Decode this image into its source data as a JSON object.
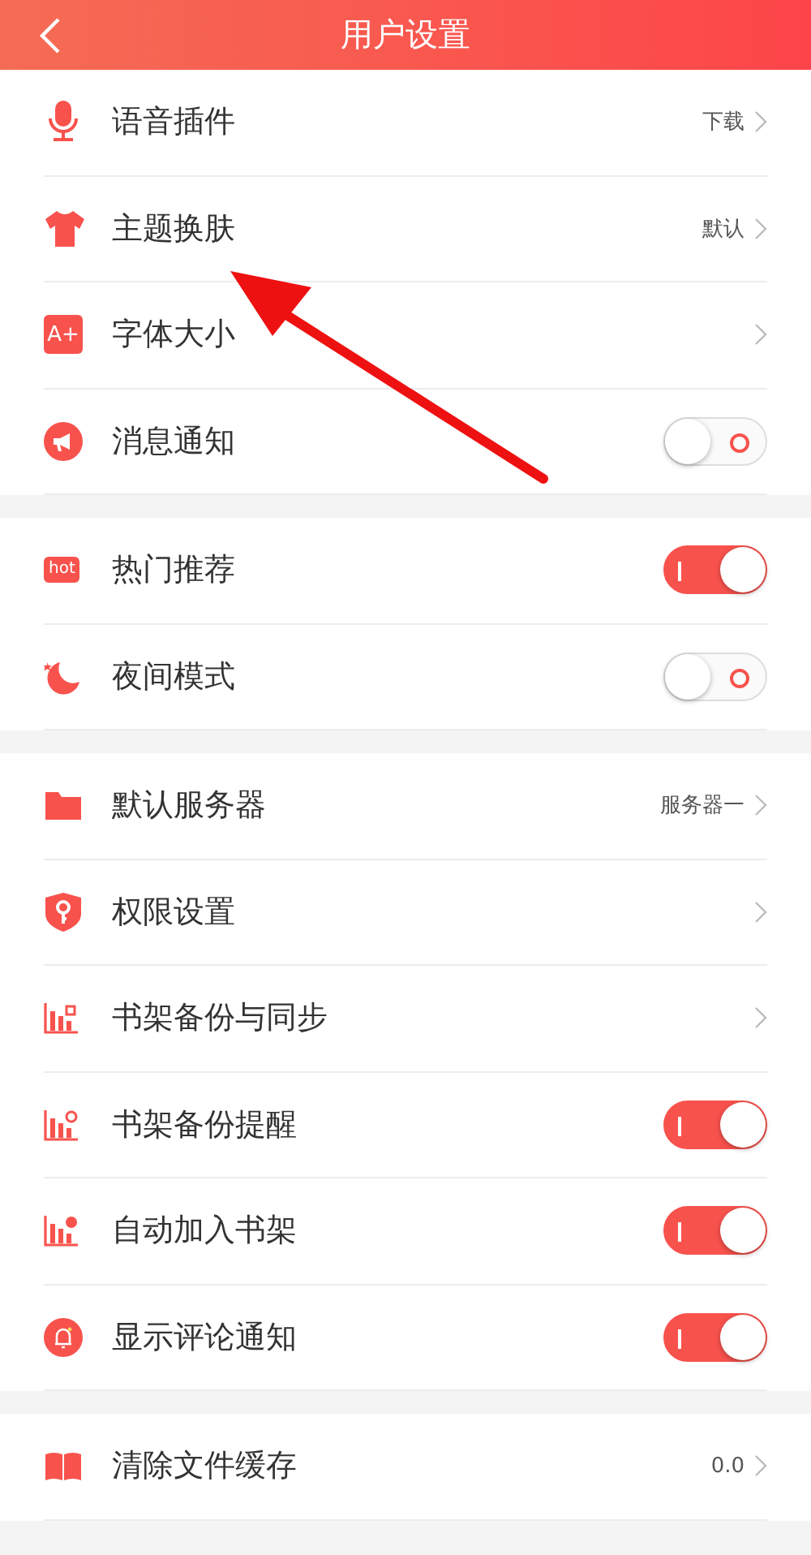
{
  "header": {
    "title": "用户设置"
  },
  "sections": [
    {
      "rows": [
        {
          "kind": "link",
          "label": "语音插件",
          "value": "下载"
        },
        {
          "kind": "link",
          "label": "主题换肤",
          "value": "默认"
        },
        {
          "kind": "link",
          "label": "字体大小",
          "icon_text": "A+"
        },
        {
          "kind": "toggle",
          "label": "消息通知",
          "on": false
        }
      ]
    },
    {
      "rows": [
        {
          "kind": "toggle",
          "label": "热门推荐",
          "on": true,
          "icon_text": "hot"
        },
        {
          "kind": "toggle",
          "label": "夜间模式",
          "on": false
        }
      ]
    },
    {
      "rows": [
        {
          "kind": "link",
          "label": "默认服务器",
          "value": "服务器一"
        },
        {
          "kind": "link",
          "label": "权限设置"
        },
        {
          "kind": "link",
          "label": "书架备份与同步"
        },
        {
          "kind": "toggle",
          "label": "书架备份提醒",
          "on": true
        },
        {
          "kind": "toggle",
          "label": "自动加入书架",
          "on": true
        },
        {
          "kind": "toggle",
          "label": "显示评论通知",
          "on": true
        }
      ]
    },
    {
      "rows": [
        {
          "kind": "link",
          "label": "清除文件缓存",
          "value": "0.0"
        }
      ]
    }
  ]
}
